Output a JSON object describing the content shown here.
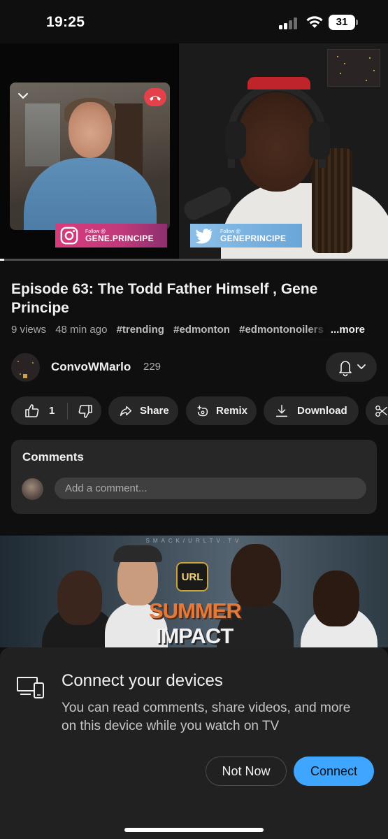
{
  "status_bar": {
    "time": "19:25",
    "battery": "31"
  },
  "video": {
    "instagram_follow": "Follow @",
    "instagram_handle": "GENE.PRINCIPE",
    "twitter_follow": "Follow @",
    "twitter_handle": "GENEPRINCIPE",
    "progress": 0.01
  },
  "title": "Episode 63: The Todd Father Himself , Gene Principe",
  "meta": {
    "views": "9 views",
    "age": "48 min ago",
    "tags": [
      "#trending",
      "#edmonton",
      "#edmontonoilers"
    ],
    "more": "...more"
  },
  "channel": {
    "name": "ConvoWMarlo",
    "subscribers": "229"
  },
  "actions": {
    "like_count": "1",
    "share": "Share",
    "remix": "Remix",
    "download": "Download"
  },
  "comments": {
    "title": "Comments",
    "placeholder": "Add a comment..."
  },
  "thumbnail": {
    "site": "SMACK/URLTV.TV",
    "badge": "URL",
    "title_line1": "SUMMER",
    "title_line2": "IMPACT"
  },
  "connect_sheet": {
    "title": "Connect your devices",
    "body": "You can read comments, share videos, and more on this device while you watch on TV",
    "not_now": "Not Now",
    "connect": "Connect"
  },
  "colors": {
    "background": "#0f0f0f",
    "surface": "#272727",
    "accent": "#3ea6ff",
    "end_call": "#e5414a"
  }
}
